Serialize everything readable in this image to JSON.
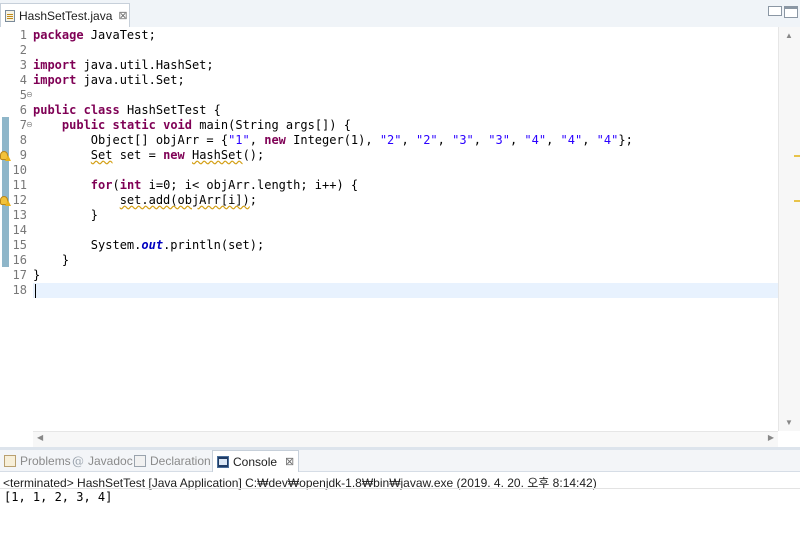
{
  "editor": {
    "tab_label": "HashSetTest.java",
    "tab_close": "⊠",
    "lines": [
      {
        "n": "1",
        "tokens": [
          {
            "t": "package",
            "c": "kw"
          },
          {
            "t": " JavaTest;"
          }
        ]
      },
      {
        "n": "2",
        "tokens": []
      },
      {
        "n": "3",
        "tokens": [
          {
            "t": "import",
            "c": "kw"
          },
          {
            "t": " java.util.HashSet;"
          }
        ]
      },
      {
        "n": "4",
        "tokens": [
          {
            "t": "import",
            "c": "kw"
          },
          {
            "t": " java.util.Set;"
          }
        ]
      },
      {
        "n": "5",
        "tokens": []
      },
      {
        "n": "6",
        "tokens": [
          {
            "t": "public",
            "c": "kw"
          },
          {
            "t": " "
          },
          {
            "t": "class",
            "c": "kw"
          },
          {
            "t": " HashSetTest {"
          }
        ]
      },
      {
        "n": "7",
        "tokens": [
          {
            "t": "    "
          },
          {
            "t": "public",
            "c": "kw"
          },
          {
            "t": " "
          },
          {
            "t": "static",
            "c": "kw"
          },
          {
            "t": " "
          },
          {
            "t": "void",
            "c": "kw"
          },
          {
            "t": " main(String args[]) {"
          }
        ]
      },
      {
        "n": "8",
        "tokens": [
          {
            "t": "        Object[] objArr = {"
          },
          {
            "t": "\"1\"",
            "c": "str"
          },
          {
            "t": ", "
          },
          {
            "t": "new",
            "c": "kw"
          },
          {
            "t": " Integer(1), "
          },
          {
            "t": "\"2\"",
            "c": "str"
          },
          {
            "t": ", "
          },
          {
            "t": "\"2\"",
            "c": "str"
          },
          {
            "t": ", "
          },
          {
            "t": "\"3\"",
            "c": "str"
          },
          {
            "t": ", "
          },
          {
            "t": "\"3\"",
            "c": "str"
          },
          {
            "t": ", "
          },
          {
            "t": "\"4\"",
            "c": "str"
          },
          {
            "t": ", "
          },
          {
            "t": "\"4\"",
            "c": "str"
          },
          {
            "t": ", "
          },
          {
            "t": "\"4\"",
            "c": "str"
          },
          {
            "t": "};"
          }
        ]
      },
      {
        "n": "9",
        "tokens": [
          {
            "t": "        "
          },
          {
            "t": "Set",
            "c": "warnline"
          },
          {
            "t": " set = "
          },
          {
            "t": "new",
            "c": "kw"
          },
          {
            "t": " "
          },
          {
            "t": "HashSet",
            "c": "warnline"
          },
          {
            "t": "();"
          }
        ]
      },
      {
        "n": "10",
        "tokens": []
      },
      {
        "n": "11",
        "tokens": [
          {
            "t": "        "
          },
          {
            "t": "for",
            "c": "kw"
          },
          {
            "t": "("
          },
          {
            "t": "int",
            "c": "kw"
          },
          {
            "t": " i=0; i< objArr.length; i++) {"
          }
        ]
      },
      {
        "n": "12",
        "tokens": [
          {
            "t": "            "
          },
          {
            "t": "set.add(objArr[i])",
            "c": "warnline"
          },
          {
            "t": ";"
          }
        ]
      },
      {
        "n": "13",
        "tokens": [
          {
            "t": "        }"
          }
        ]
      },
      {
        "n": "14",
        "tokens": []
      },
      {
        "n": "15",
        "tokens": [
          {
            "t": "        System."
          },
          {
            "t": "out",
            "c": "fld"
          },
          {
            "t": ".println(set);"
          }
        ]
      },
      {
        "n": "16",
        "tokens": [
          {
            "t": "    }"
          }
        ]
      },
      {
        "n": "17",
        "tokens": [
          {
            "t": "}"
          }
        ]
      },
      {
        "n": "18",
        "tokens": []
      }
    ],
    "fold_icon": "⊖"
  },
  "panel": {
    "tabs": [
      {
        "label": "Problems",
        "icon": "problems-icon",
        "active": false
      },
      {
        "label": "Javadoc",
        "icon": "javadoc-icon",
        "active": false
      },
      {
        "label": "Declaration",
        "icon": "declaration-icon",
        "active": false
      },
      {
        "label": "Console",
        "icon": "console-icon",
        "active": true
      }
    ],
    "console_close": "⊠",
    "status": "<terminated> HashSetTest [Java Application] C:₩dev₩openjdk-1.8₩bin₩javaw.exe (2019. 4. 20. 오후 8:14:42)",
    "output": "[1, 1, 2, 3, 4]"
  },
  "colors": {
    "keyword": "#7f0055",
    "string": "#2a00ff",
    "field": "#0000c0",
    "current_line": "#e8f2fe",
    "change_bar": "#8fb6c9"
  }
}
